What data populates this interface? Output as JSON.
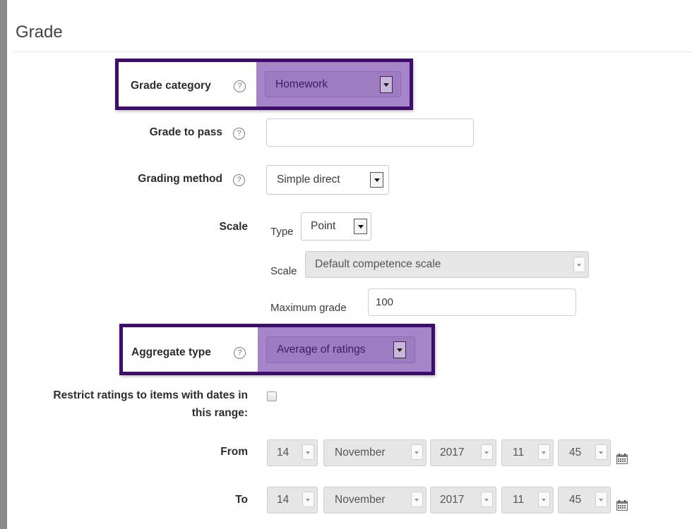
{
  "section": {
    "title": "Grade"
  },
  "grade_category": {
    "label": "Grade category",
    "value": "Homework"
  },
  "grade_to_pass": {
    "label": "Grade to pass",
    "value": ""
  },
  "grading_method": {
    "label": "Grading method",
    "value": "Simple direct"
  },
  "scale": {
    "label": "Scale",
    "type_label": "Type",
    "type_value": "Point",
    "scale_label": "Scale",
    "scale_value": "Default competence scale",
    "max_label": "Maximum grade",
    "max_value": "100"
  },
  "aggregate_type": {
    "label": "Aggregate type",
    "value": "Average of ratings"
  },
  "restrict": {
    "label_line1": "Restrict ratings to items with dates in",
    "label_line2": "this range:",
    "checked": false
  },
  "from": {
    "label": "From",
    "day": "14",
    "month": "November",
    "year": "2017",
    "hour": "11",
    "minute": "45"
  },
  "to": {
    "label": "To",
    "day": "14",
    "month": "November",
    "year": "2017",
    "hour": "11",
    "minute": "45"
  },
  "icons": {
    "help": "help-icon",
    "calendar": "calendar-icon"
  },
  "colors": {
    "highlight_border": "#3d0e6e",
    "highlight_fill": "#a585c7"
  }
}
